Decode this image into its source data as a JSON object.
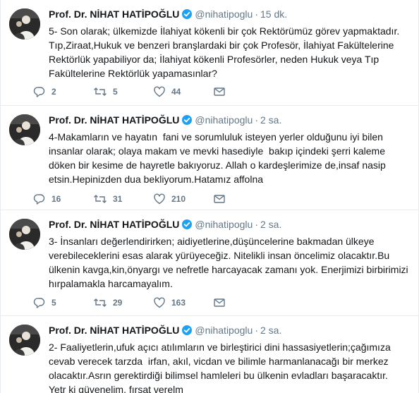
{
  "tweets": [
    {
      "name": "Prof. Dr. NİHAT HATİPOĞLU",
      "handle": "@nihatipoglu",
      "time": "15 dk.",
      "text": "5- Son olarak; ülkemizde İlahiyat kökenli bir çok Rektörümüz görev yapmaktadır.\nTıp,Ziraat,Hukuk ve benzeri branşlardaki bir çok Profesör, İlahiyat Fakültelerine\nRektörlük yapabiliyor da; İlahiyat kökenli Profesörler, neden Hukuk veya Tıp\nFakültelerine Rektörlük yapamasınlar?",
      "replies": "2",
      "retweets": "5",
      "likes": "44"
    },
    {
      "name": "Prof. Dr. NİHAT HATİPOĞLU",
      "handle": "@nihatipoglu",
      "time": "2 sa.",
      "text": "4-Makamların ve hayatın  fani ve sorumluluk isteyen yerler olduğunu iyi bilen\ninsanlar olarak; olaya makam ve mevki hasediyle  bakıp içindeki şerri kaleme\ndöken bir kesime de hayretle bakıyoruz. Allah o kardeşlerimize de,insaf nasip\netsin.Hepinizden dua bekliyorum.Hatamız affolna",
      "replies": "16",
      "retweets": "31",
      "likes": "210"
    },
    {
      "name": "Prof. Dr. NİHAT HATİPOĞLU",
      "handle": "@nihatipoglu",
      "time": "2 sa.",
      "text": "3- İnsanları değerlendirirken; aidiyetlerine,düşüncelerine bakmadan ülkeye\nverebileceklerini esas alarak yürüyeceğiz. Nitelikli insan öncelimiz olacaktır.Bu\nülkenin kavga,kin,önyargı ve nefretle harcayacak zamanı yok. Enerjimizi birbirimizi\nhırpalamakla harcamayalım.",
      "replies": "5",
      "retweets": "29",
      "likes": "163"
    },
    {
      "name": "Prof. Dr. NİHAT HATİPOĞLU",
      "handle": "@nihatipoglu",
      "time": "2 sa.",
      "text": "2- Faaliyetlerin,ufuk açıcı atılımların ve birleştirici dini hassasiyetlerin;çağımıza\ncevab verecek tarzda  irfan, akıl, vicdan ve bilimle harmanlanacağı bir merkez\nolacaktır.Asrın gerektirdiği bilimsel hamleleri bu ülkenin evladları başaracaktır.\nYetr ki güvenelim, fırsat verelm",
      "replies": "",
      "retweets": "",
      "likes": ""
    }
  ],
  "icons": {
    "verified": "verified-badge-icon",
    "reply": "reply-icon",
    "retweet": "retweet-icon",
    "like": "heart-icon",
    "dm": "envelope-icon"
  },
  "colors": {
    "verified": "#1da1f2",
    "muted": "#657786",
    "text": "#14171a",
    "border": "#e6ecf0"
  }
}
